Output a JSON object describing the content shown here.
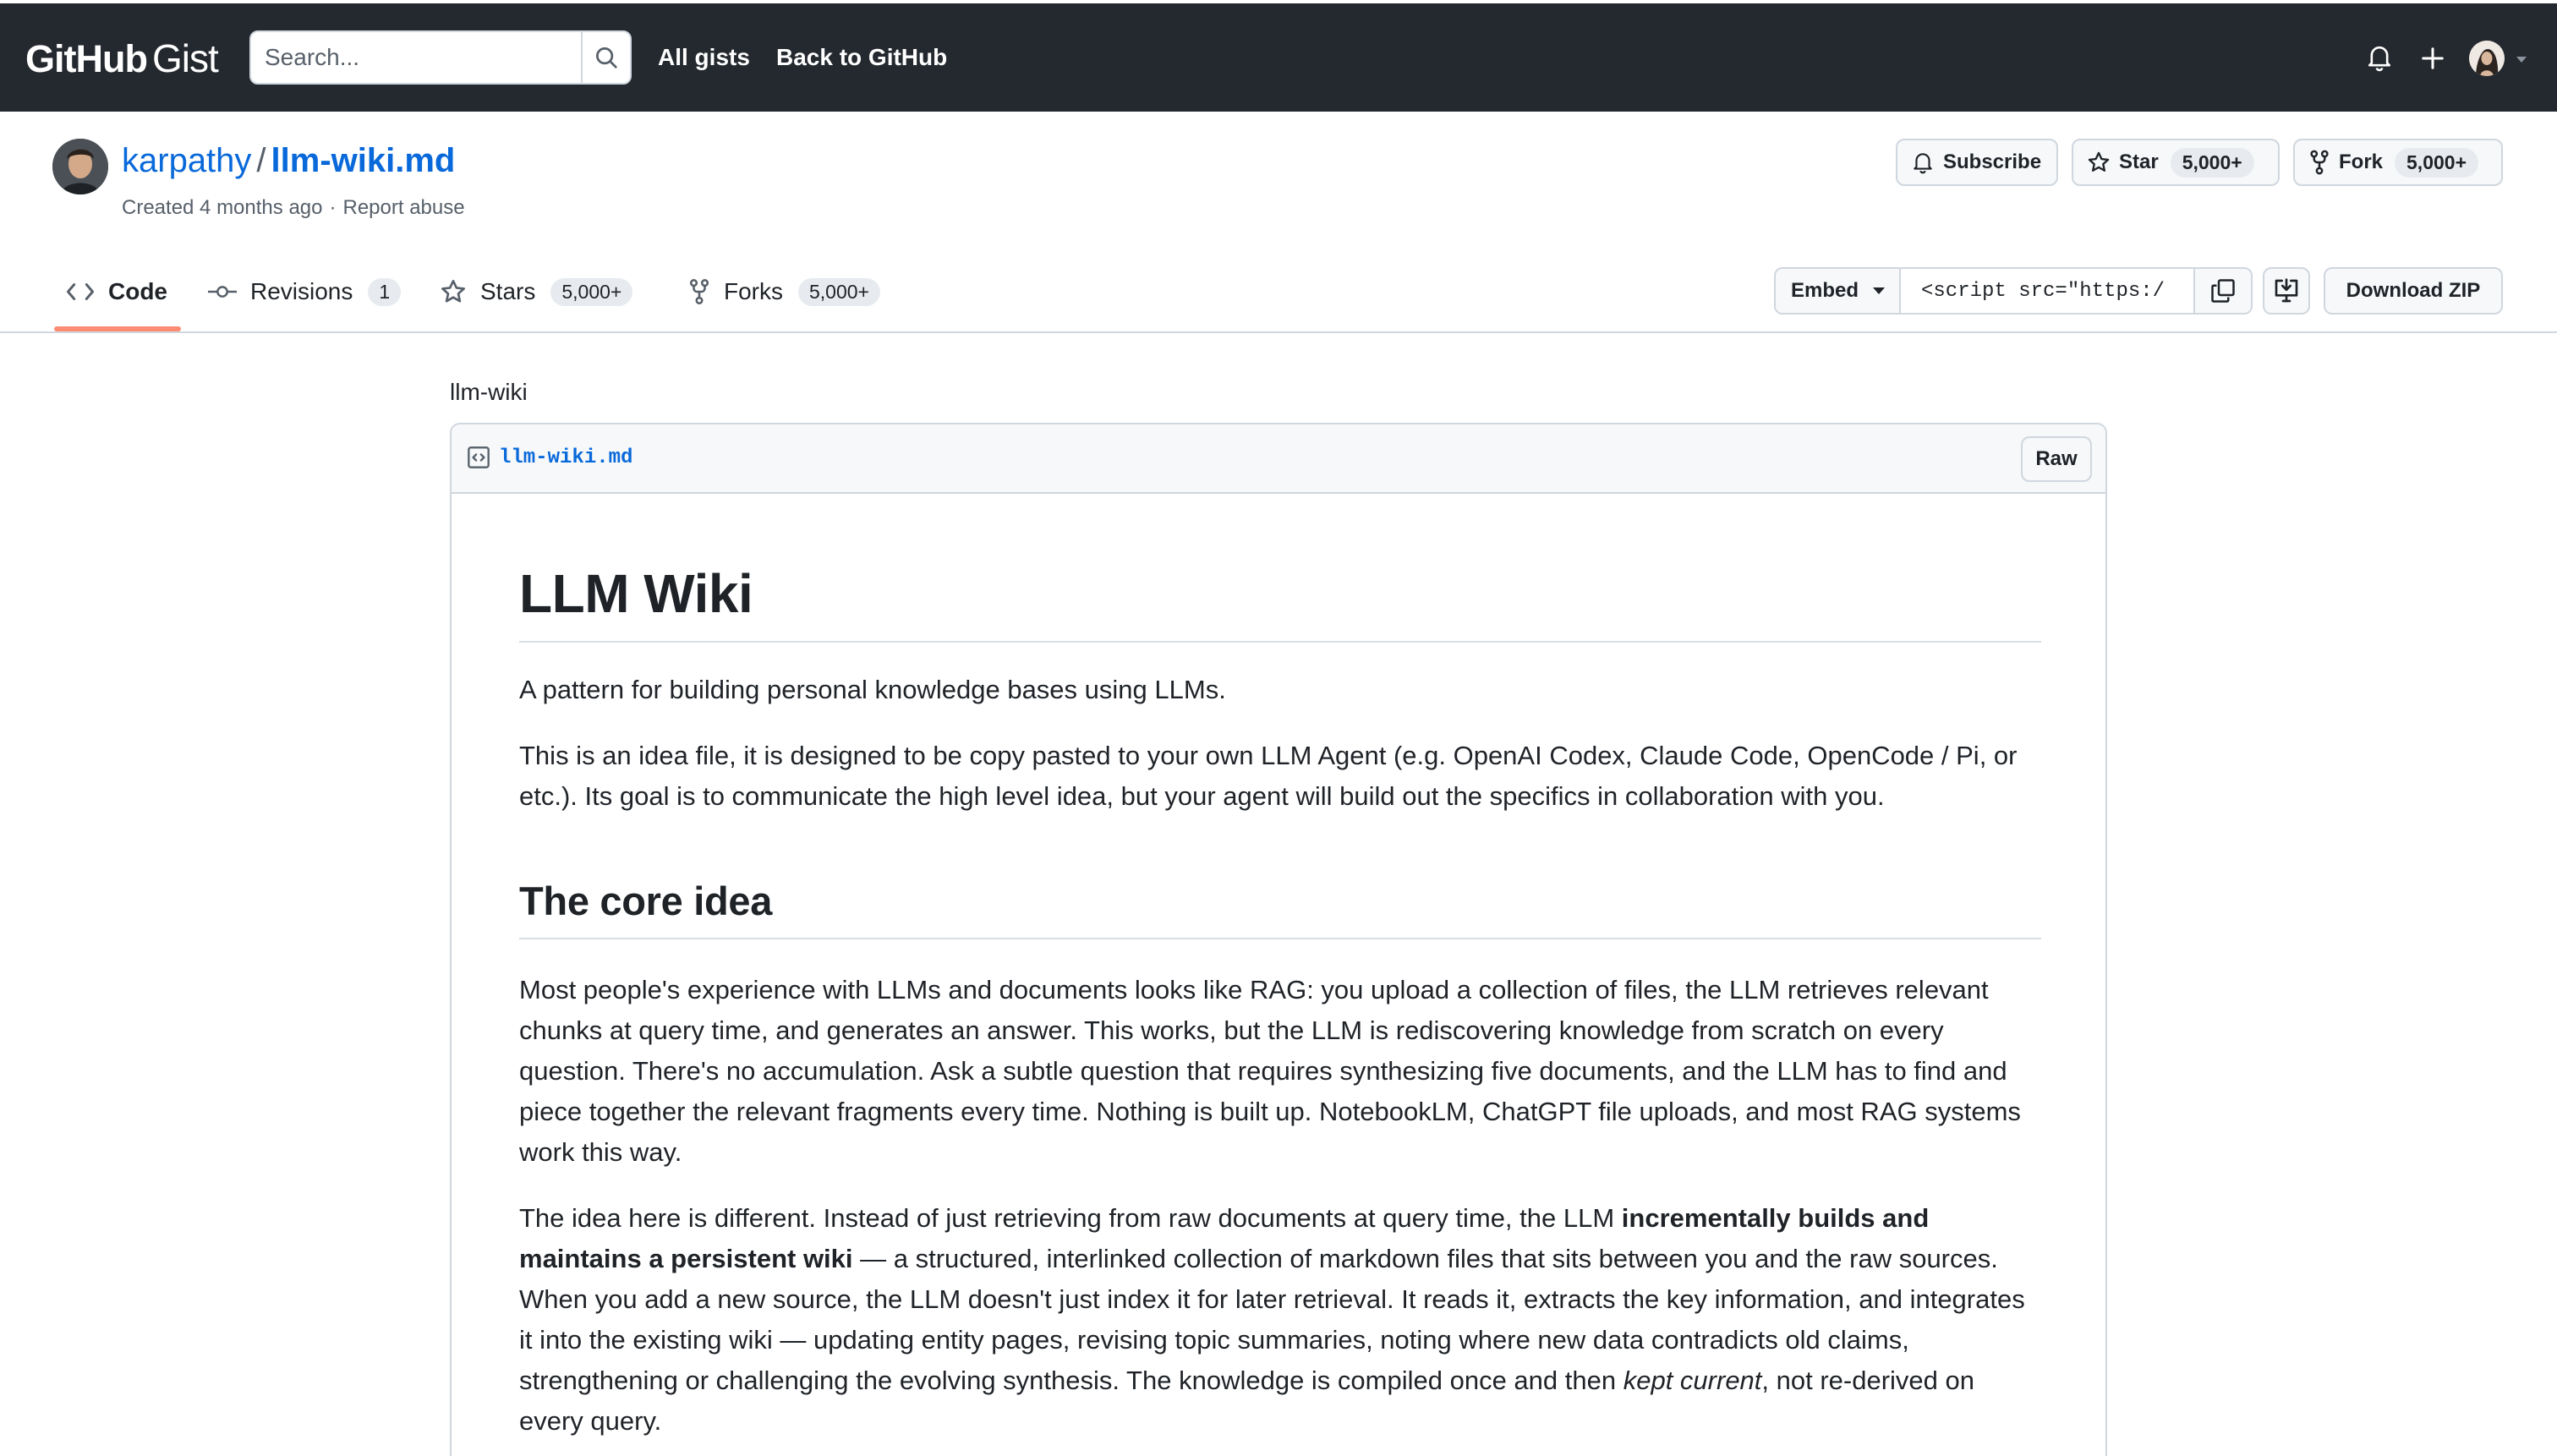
{
  "header": {
    "logo_github": "GitHub",
    "logo_gist": "Gist",
    "search_placeholder": "Search...",
    "nav": [
      "All gists",
      "Back to GitHub"
    ]
  },
  "gist": {
    "owner": "karpathy",
    "separator": "/",
    "filename": "llm-wiki.md",
    "created": "Created 4 months ago",
    "report_abuse": "Report abuse"
  },
  "actions": {
    "subscribe": "Subscribe",
    "star": "Star",
    "star_count": "5,000+",
    "fork": "Fork",
    "fork_count": "5,000+"
  },
  "tabs": [
    {
      "label": "Code",
      "count": ""
    },
    {
      "label": "Revisions",
      "count": "1"
    },
    {
      "label": "Stars",
      "count": "5,000+"
    },
    {
      "label": "Forks",
      "count": "5,000+"
    }
  ],
  "embed": {
    "select_value": "Embed",
    "url_value": "<script src=\"https:/",
    "download": "Download ZIP"
  },
  "content": {
    "description": "llm-wiki",
    "file_name": "llm-wiki.md",
    "raw": "Raw",
    "h1": "LLM Wiki",
    "p1": "A pattern for building personal knowledge bases using LLMs.",
    "p2": "This is an idea file, it is designed to be copy pasted to your own LLM Agent (e.g. OpenAI Codex, Claude Code, OpenCode / Pi, or etc.). Its goal is to communicate the high level idea, but your agent will build out the specifics in collaboration with you.",
    "h2": "The core idea",
    "p3": "Most people's experience with LLMs and documents looks like RAG: you upload a collection of files, the LLM retrieves relevant chunks at query time, and generates an answer. This works, but the LLM is rediscovering knowledge from scratch on every question. There's no accumulation. Ask a subtle question that requires synthesizing five documents, and the LLM has to find and piece together the relevant fragments every time. Nothing is built up. NotebookLM, ChatGPT file uploads, and most RAG systems work this way.",
    "p4_a": "The idea here is different. Instead of just retrieving from raw documents at query time, the LLM ",
    "p4_b": "incrementally builds and maintains a persistent wiki",
    "p4_c": " — a structured, interlinked collection of markdown files that sits between you and the raw sources. When you add a new source, the LLM doesn't just index it for later retrieval. It reads it, extracts the key information, and integrates it into the existing wiki — updating entity pages, revising topic summaries, noting where new data contradicts old claims, strengthening or challenging the evolving synthesis. The knowledge is compiled once and then ",
    "p4_d": "kept current",
    "p4_e": ", not re-derived on every query."
  },
  "colors": {
    "header_bg": "#24292f",
    "link": "#0969da",
    "tab_underline": "#fd8c73",
    "border": "#d0d7de"
  }
}
